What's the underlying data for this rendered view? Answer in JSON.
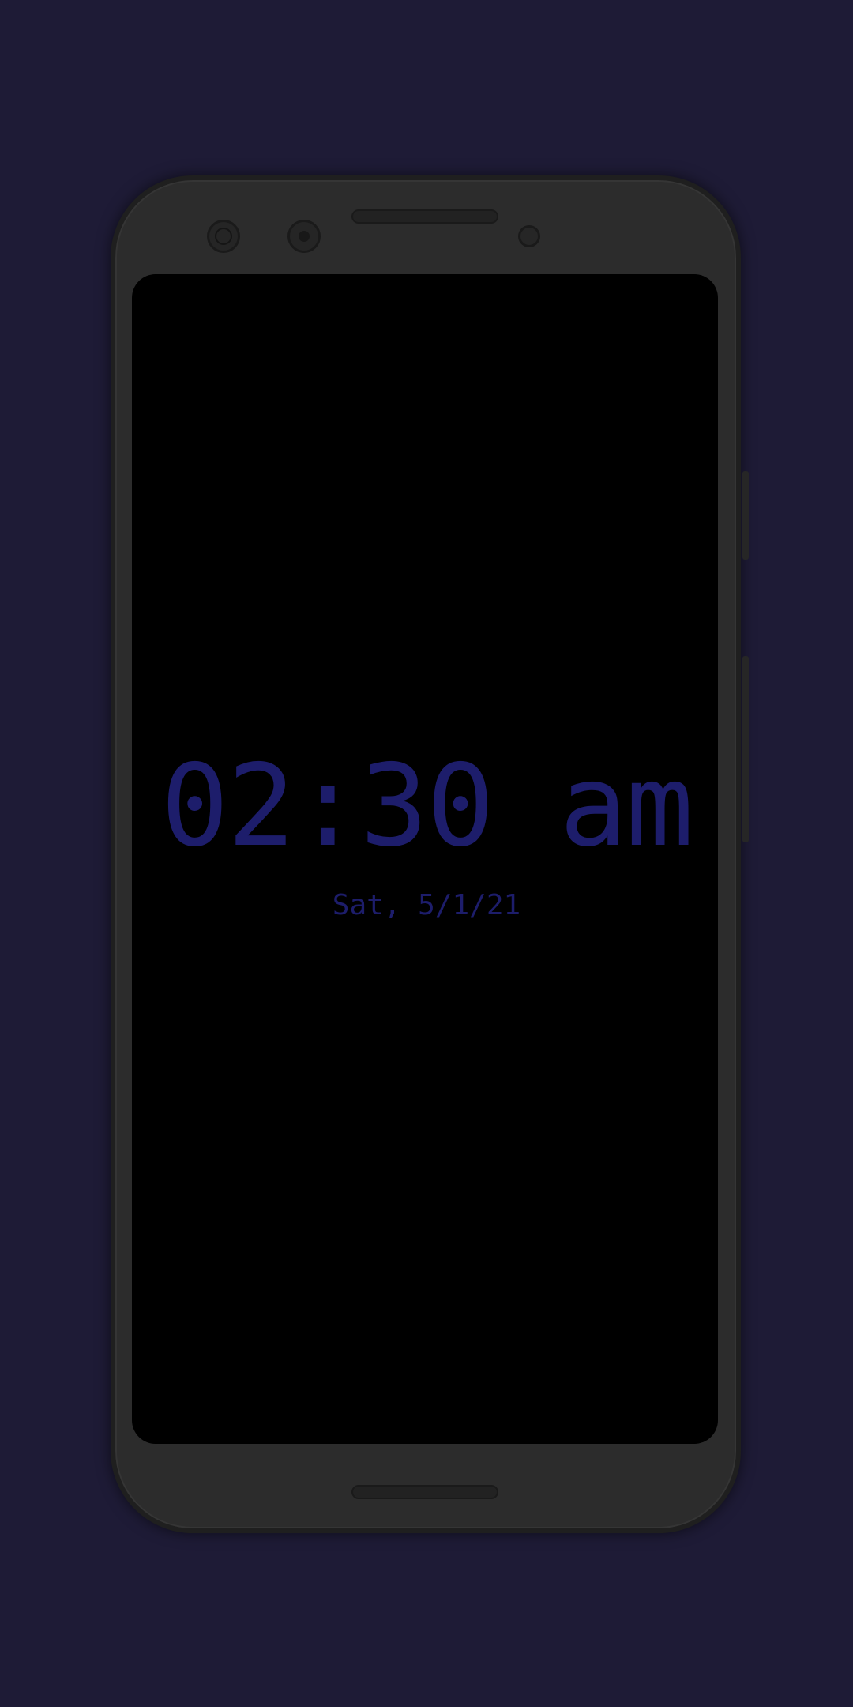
{
  "clock": {
    "time": "02:30 am",
    "date": "Sat, 5/1/21"
  },
  "colors": {
    "background": "#1e1b36",
    "phone_body": "#2c2c2c",
    "screen": "#000000",
    "clock_text": "#1d1d6b"
  },
  "icons": {
    "front_camera": "camera-icon",
    "secondary_camera": "camera-icon",
    "proximity_sensor": "sensor-icon"
  }
}
